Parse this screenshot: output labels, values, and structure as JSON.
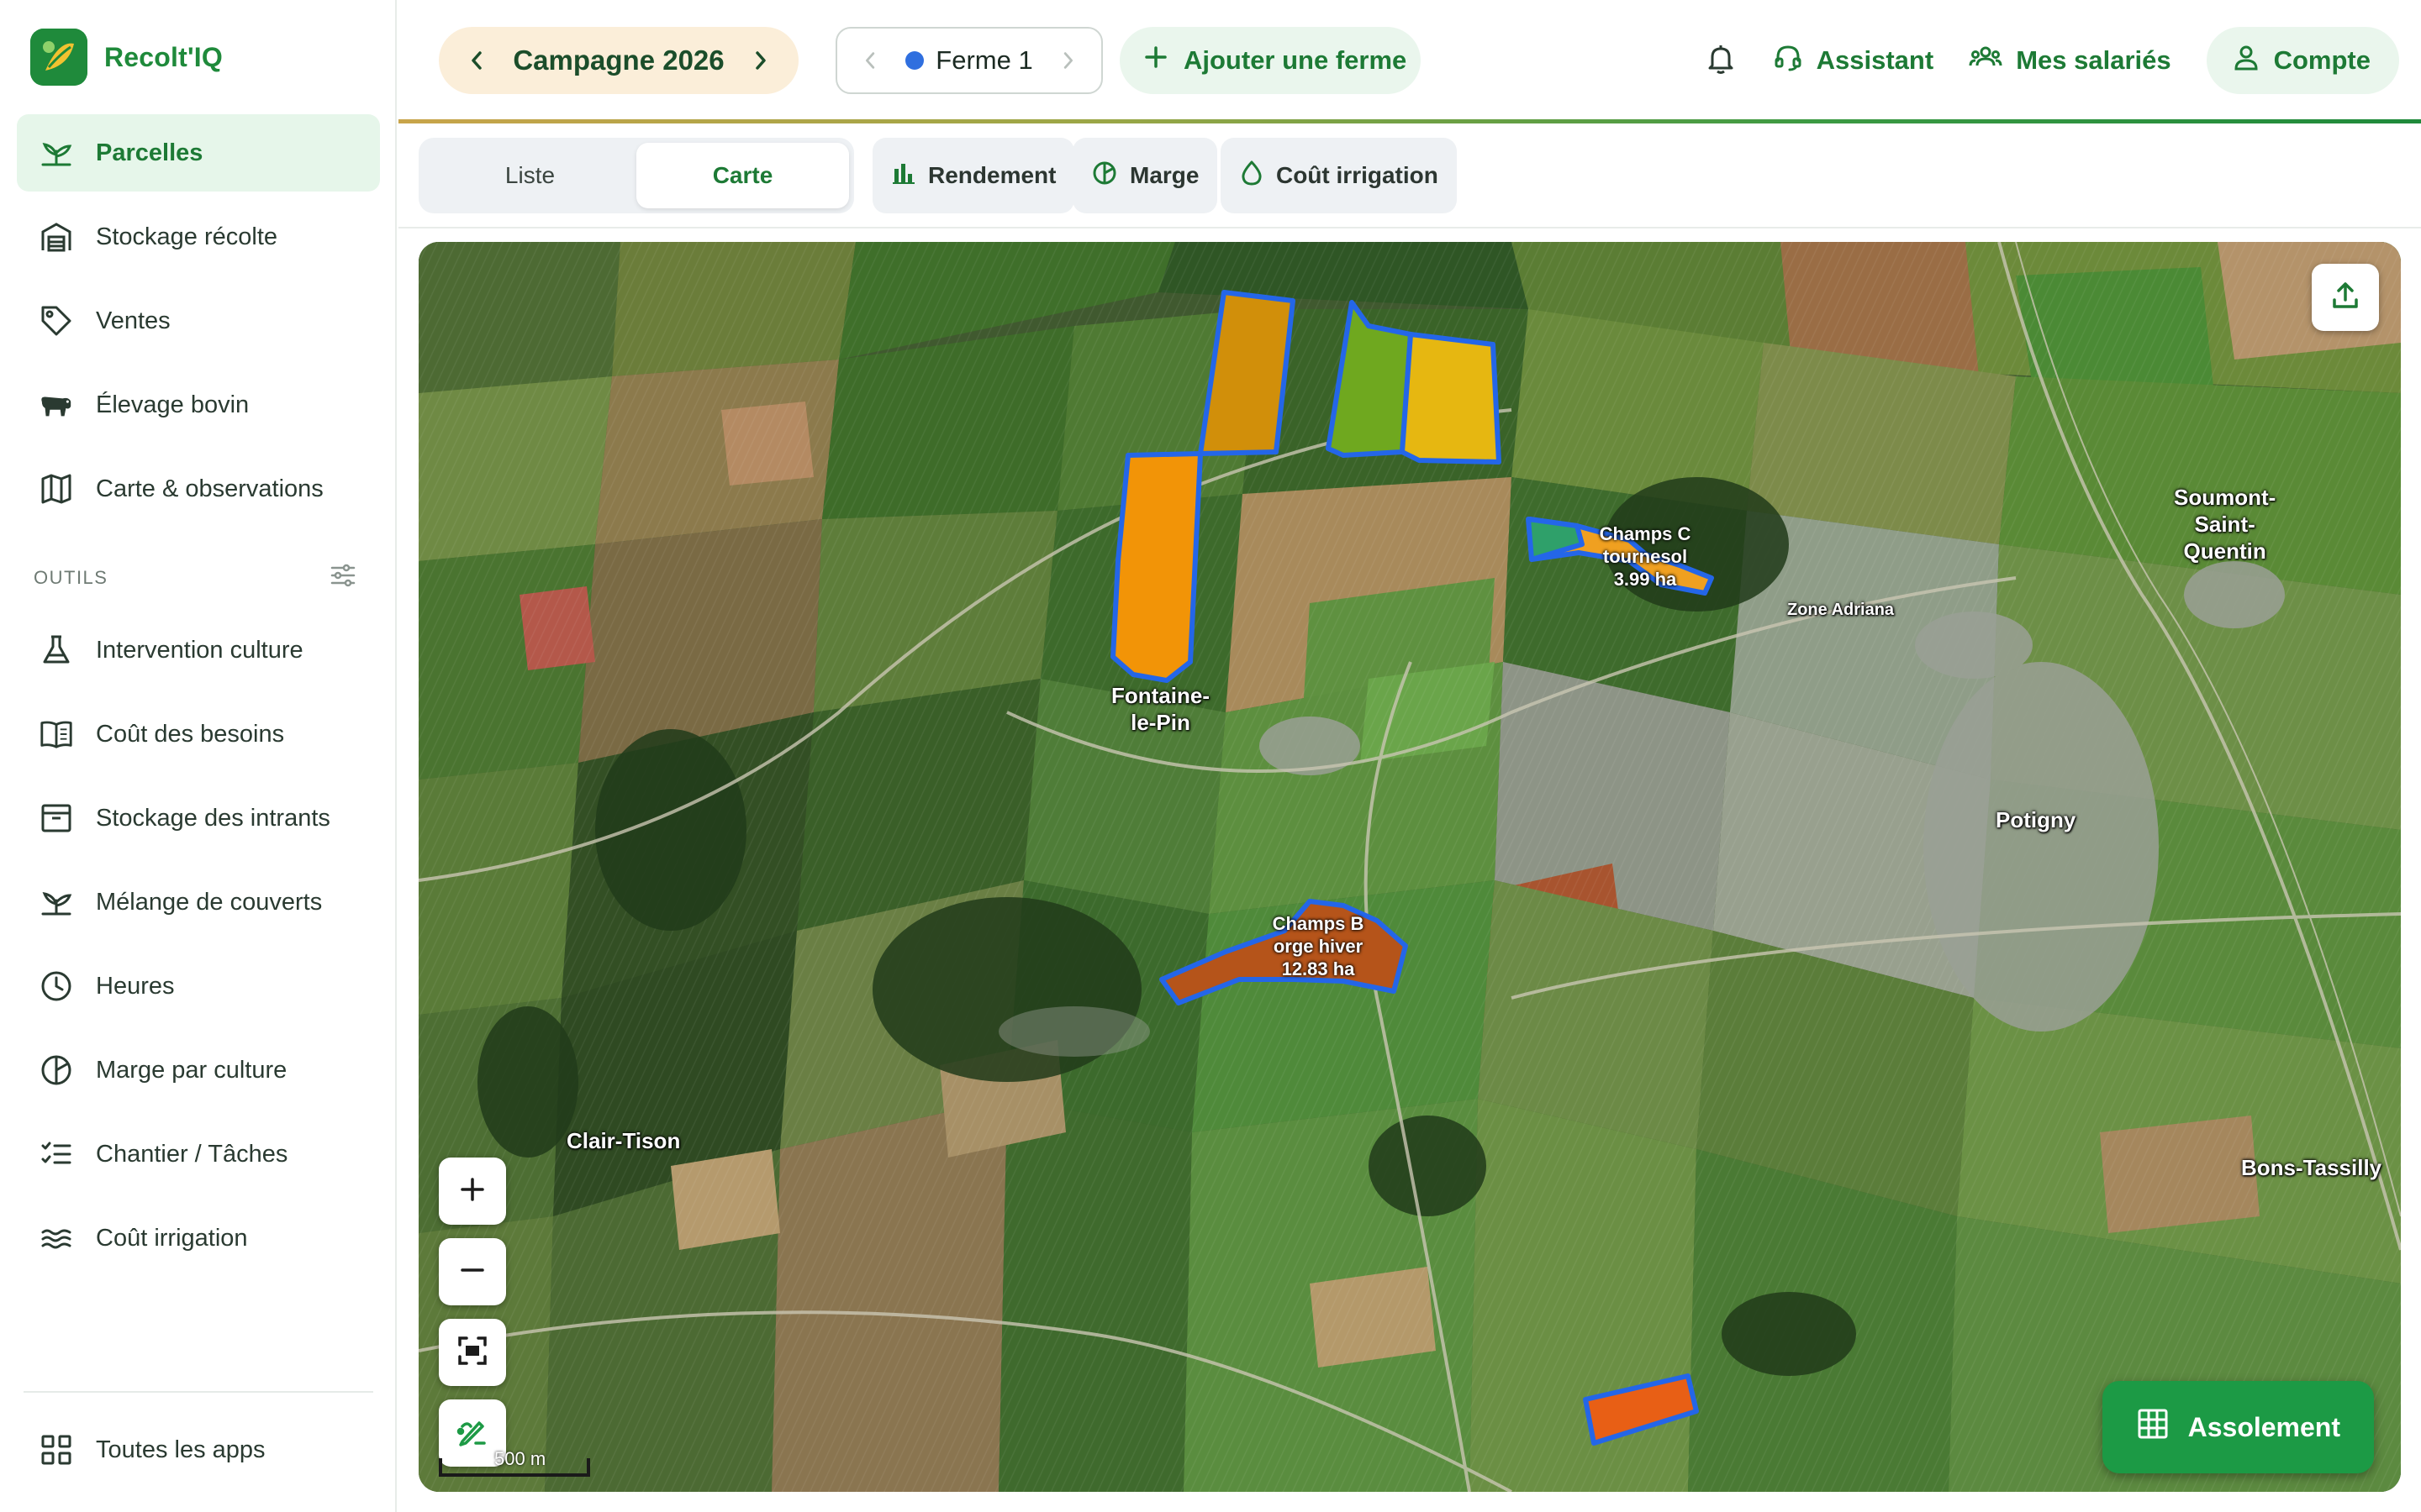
{
  "app": {
    "name": "Recolt'IQ"
  },
  "sidebar": {
    "items": [
      {
        "label": "Parcelles",
        "icon": "sprout-icon",
        "active": true
      },
      {
        "label": "Stockage récolte",
        "icon": "silo-icon"
      },
      {
        "label": "Ventes",
        "icon": "tag-icon"
      },
      {
        "label": "Élevage bovin",
        "icon": "cow-icon"
      },
      {
        "label": "Carte & observations",
        "icon": "map-icon"
      }
    ],
    "tools_heading": "OUTILS",
    "tools": [
      {
        "label": "Intervention culture",
        "icon": "flask-icon"
      },
      {
        "label": "Coût des besoins",
        "icon": "book-icon"
      },
      {
        "label": "Stockage des intrants",
        "icon": "archive-icon"
      },
      {
        "label": "Mélange de couverts",
        "icon": "sprout-icon"
      },
      {
        "label": "Heures",
        "icon": "clock-icon"
      },
      {
        "label": "Marge par culture",
        "icon": "pie-icon"
      },
      {
        "label": "Chantier / Tâches",
        "icon": "checklist-icon"
      },
      {
        "label": "Coût irrigation",
        "icon": "waves-icon"
      }
    ],
    "all_apps": "Toutes les apps"
  },
  "header": {
    "campaign": "Campagne 2026",
    "farm": "Ferme 1",
    "farm_color": "#2f6fdf",
    "add_farm": "Ajouter une ferme",
    "assistant": "Assistant",
    "employees": "Mes salariés",
    "account": "Compte"
  },
  "toolbar": {
    "view_list": "Liste",
    "view_map": "Carte",
    "active_view": "Carte",
    "yield": "Rendement",
    "margin": "Marge",
    "irrigation_cost": "Coût irrigation"
  },
  "map": {
    "places": [
      "Fontaine-\nle-Pin",
      "Soumont-\nSaint-\nQuentin",
      "Zone Adriana",
      "Potigny",
      "Clair-Tison",
      "Bons-Tassilly"
    ],
    "parcels": [
      {
        "name": "Champs B",
        "crop": "orge hiver",
        "area": "12.83 ha",
        "fill": "#b5541a"
      },
      {
        "name": "Champs C",
        "crop": "tournesol",
        "area": "3.99 ha",
        "fill": "#f0a020"
      }
    ],
    "parcel_colors": [
      "#d18f0a",
      "#6fa81f",
      "#e6b711",
      "#f29407",
      "#f0a020",
      "#e85f15"
    ],
    "outline_color": "#2466e8",
    "scale_label": "500 m"
  },
  "assolement": "Assolement",
  "colors": {
    "brand": "#1f8a3b",
    "active_bg": "#e6f6ea",
    "campaign_bg": "#fbeed9",
    "cta": "#1c9a45"
  }
}
